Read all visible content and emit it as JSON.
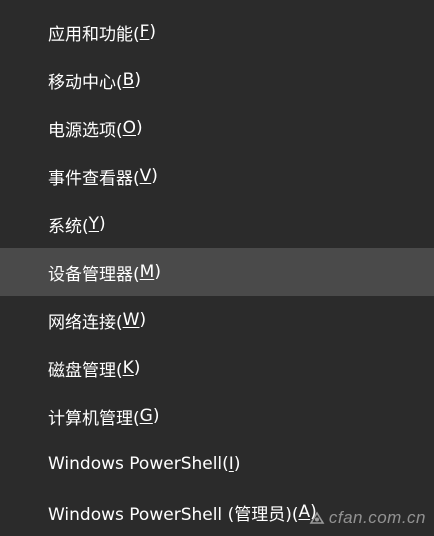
{
  "menu": {
    "items": [
      {
        "label": "应用和功能(",
        "key": "F",
        "tail": ")"
      },
      {
        "label": "移动中心(",
        "key": "B",
        "tail": ")"
      },
      {
        "label": "电源选项(",
        "key": "O",
        "tail": ")"
      },
      {
        "label": "事件查看器(",
        "key": "V",
        "tail": ")"
      },
      {
        "label": "系统(",
        "key": "Y",
        "tail": ")"
      },
      {
        "label": "设备管理器(",
        "key": "M",
        "tail": ")"
      },
      {
        "label": "网络连接(",
        "key": "W",
        "tail": ")"
      },
      {
        "label": "磁盘管理(",
        "key": "K",
        "tail": ")"
      },
      {
        "label": "计算机管理(",
        "key": "G",
        "tail": ")"
      },
      {
        "label": "Windows PowerShell(",
        "key": "I",
        "tail": ")"
      },
      {
        "label": "Windows PowerShell (管理员)(",
        "key": "A",
        "tail": ")"
      }
    ],
    "highlighted_index": 5
  },
  "watermark": {
    "text": "cfan.com.cn",
    "icon": "cfan-logo-icon"
  },
  "colors": {
    "background": "#2b2b2b",
    "highlight": "#4a4a4a",
    "text": "#ffffff"
  }
}
